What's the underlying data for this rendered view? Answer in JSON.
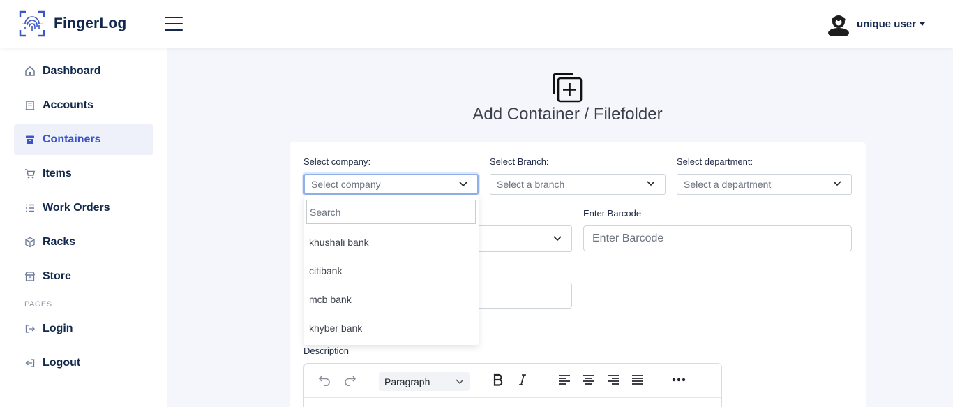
{
  "brand": {
    "name": "FingerLog"
  },
  "user": {
    "name": "unique user"
  },
  "sidebar": {
    "items": [
      {
        "label": "Dashboard"
      },
      {
        "label": "Accounts"
      },
      {
        "label": "Containers"
      },
      {
        "label": "Items"
      },
      {
        "label": "Work Orders"
      },
      {
        "label": "Racks"
      },
      {
        "label": "Store"
      }
    ],
    "section": "PAGES",
    "pages": [
      {
        "label": "Login"
      },
      {
        "label": "Logout"
      }
    ]
  },
  "main": {
    "title": "Add Container / Filefolder",
    "company_label": "Select company:",
    "company_placeholder": "Select company",
    "branch_label": "Select Branch:",
    "branch_placeholder": "Select a branch",
    "department_label": "Select department:",
    "department_placeholder": "Select a department",
    "barcode_label": "Enter Barcode",
    "barcode_placeholder": "Enter Barcode",
    "description_label": "Description",
    "editor_paragraph": "Paragraph"
  },
  "dropdown": {
    "search_placeholder": "Search",
    "options": [
      "khushali bank",
      "citibank",
      "mcb bank",
      "khyber bank"
    ]
  },
  "colors": {
    "primary": "#12294d",
    "accent": "#3a55c9",
    "active_bg": "#eef1f9"
  }
}
